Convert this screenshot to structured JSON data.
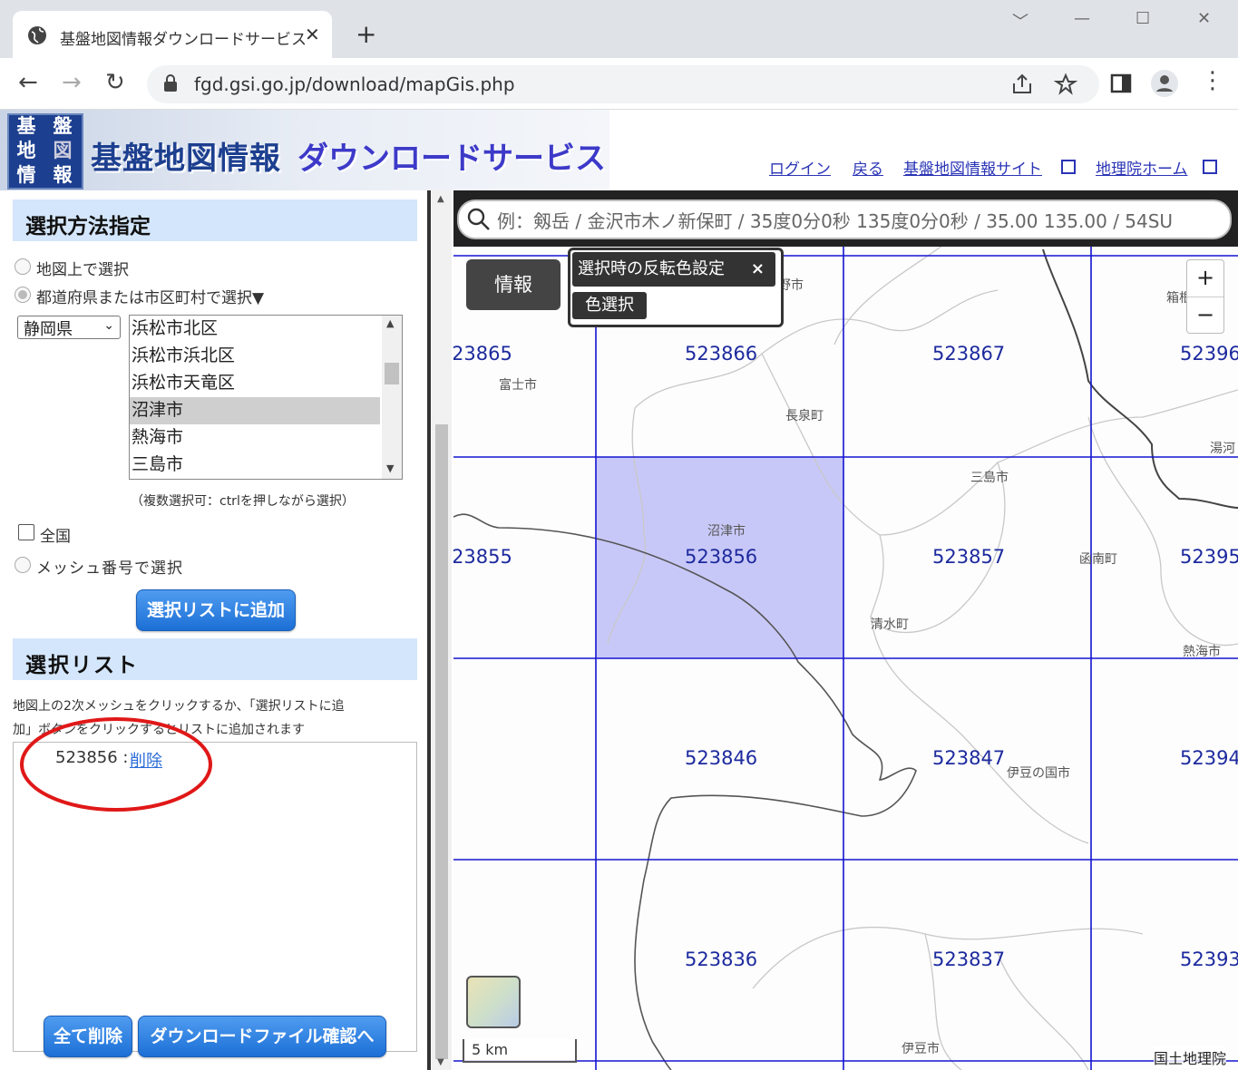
{
  "browser": {
    "tab_title": "基盤地図情報ダウンロードサービス",
    "url": "fgd.gsi.go.jp/download/mapGis.php"
  },
  "header": {
    "logo_chars": [
      "基",
      "盤",
      "地",
      "図",
      "情",
      "報"
    ],
    "title": "基盤地図情報",
    "subtitle": "ダウンロードサービス",
    "links": [
      "ログイン",
      "戻る",
      "基盤地図情報サイト",
      "地理院ホーム"
    ]
  },
  "left": {
    "method_heading": "選択方法指定",
    "radio_map": "地図上で選択",
    "radio_pref": "都道府県または市区町村で選択▼",
    "pref_selected": "静岡県",
    "cities": [
      "浜松市北区",
      "浜松市浜北区",
      "浜松市天竜区",
      "沼津市",
      "熱海市",
      "三島市"
    ],
    "selected_city": "沼津市",
    "multi_note": "（複数選択可：ctrlを押しながら選択）",
    "nationwide": "全国",
    "radio_mesh": "メッシュ番号で選択",
    "add_button": "選択リストに追加",
    "list_heading": "選択リスト",
    "list_help_1": "地図上の2次メッシュをクリックするか、「選択リストに追",
    "list_help_2": "加」ボタンをクリックするとリストに追加されます",
    "entry_code": "523856 : ",
    "entry_delete": "削除",
    "delete_all": "全て削除",
    "to_download": "ダウンロードファイル確認へ"
  },
  "map": {
    "search_placeholder": "例：剱岳 / 金沢市木ノ新保町 / 35度0分0秒 135度0分0秒 / 35.00 135.00 / 54SU",
    "info_button": "情報",
    "popup_title": "選択時の反転色設定",
    "popup_close": "×",
    "color_select": "色選択",
    "zoom_in": "+",
    "zoom_out": "−",
    "scale": "5 km",
    "attribution": "国土地理院",
    "selected_color": "#c8c8f8",
    "grid_color": "#1414d2",
    "mesh_labels": [
      "23865",
      "523866",
      "523867",
      "52396",
      "23855",
      "523856",
      "523857",
      "52395",
      "523846",
      "523847",
      "52394",
      "523836",
      "523837",
      "52393"
    ],
    "places": [
      "富士市",
      "長泉町",
      "三島市",
      "沼津市",
      "函南町",
      "清水町",
      "熱海市",
      "伊豆の国市",
      "伊豆市",
      "湯河",
      "箱根",
      "野市"
    ]
  }
}
